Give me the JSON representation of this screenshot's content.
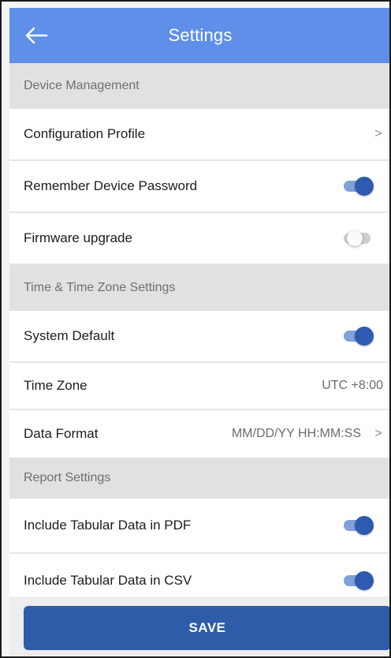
{
  "header": {
    "title": "Settings",
    "back_icon": "arrow-left-icon"
  },
  "sections": {
    "device": {
      "title": "Device Management",
      "configuration_profile": {
        "label": "Configuration Profile",
        "chevron": ">"
      },
      "remember_password": {
        "label": "Remember Device Password",
        "enabled": true
      },
      "firmware_upgrade": {
        "label": "Firmware upgrade",
        "enabled": false
      }
    },
    "time": {
      "title": "Time & Time Zone Settings",
      "system_default": {
        "label": "System Default",
        "enabled": true
      },
      "time_zone": {
        "label": "Time Zone",
        "value": "UTC +8:00"
      },
      "data_format": {
        "label": "Data Format",
        "value": "MM/DD/YY HH:MM:SS",
        "chevron": ">"
      }
    },
    "report": {
      "title": "Report Settings",
      "tabular_pdf": {
        "label": "Include Tabular Data in PDF",
        "enabled": true
      },
      "tabular_csv": {
        "label": "Include Tabular Data in CSV",
        "enabled": true
      }
    }
  },
  "footer": {
    "save_label": "SAVE"
  },
  "colors": {
    "app_bar": "#5f8fe8",
    "accent": "#2f5ca8",
    "toggle_track_on": "#7fa0d9"
  }
}
